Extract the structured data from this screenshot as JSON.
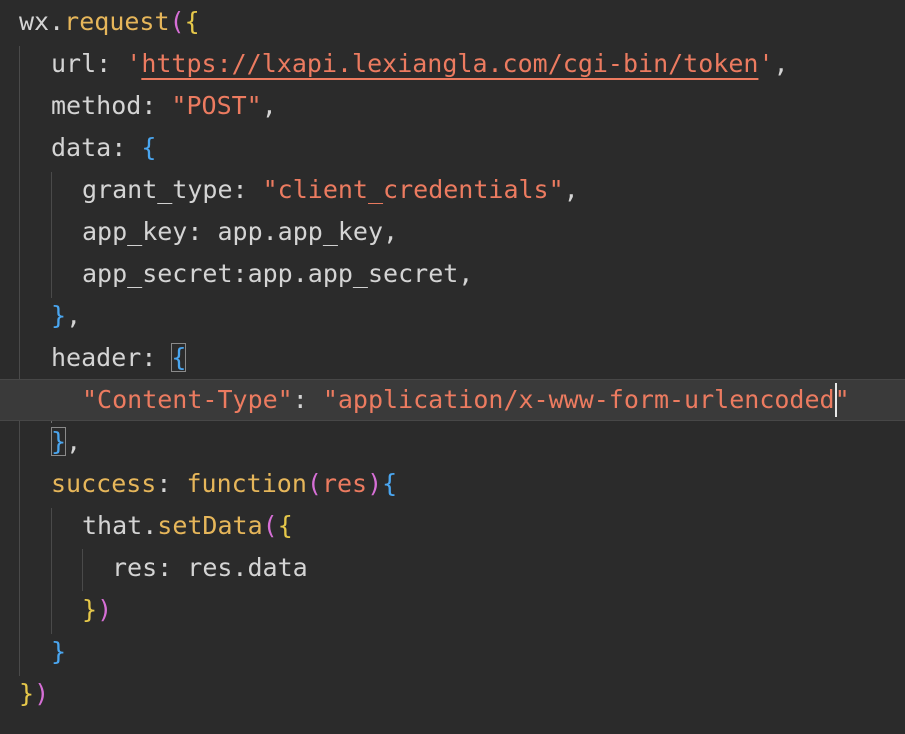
{
  "editor": {
    "language": "javascript",
    "cursor_line": 10,
    "lines": [
      {
        "tokens": [
          {
            "t": "wx",
            "c": "default"
          },
          {
            "t": ".",
            "c": "default"
          },
          {
            "t": "request",
            "c": "func"
          },
          {
            "t": "(",
            "c": "brace1"
          },
          {
            "t": "{",
            "c": "brace2"
          }
        ]
      },
      {
        "tokens": [
          {
            "t": "url",
            "c": "default"
          },
          {
            "t": ": ",
            "c": "default"
          },
          {
            "t": "'",
            "c": "string"
          },
          {
            "t": "https://lxapi.lexiangla.com/cgi-bin/token",
            "c": "url"
          },
          {
            "t": "'",
            "c": "string"
          },
          {
            "t": ",",
            "c": "default"
          }
        ]
      },
      {
        "tokens": [
          {
            "t": "method",
            "c": "default"
          },
          {
            "t": ": ",
            "c": "default"
          },
          {
            "t": "\"POST\"",
            "c": "string"
          },
          {
            "t": ",",
            "c": "default"
          }
        ]
      },
      {
        "tokens": [
          {
            "t": "data",
            "c": "default"
          },
          {
            "t": ": ",
            "c": "default"
          },
          {
            "t": "{",
            "c": "brace3"
          }
        ]
      },
      {
        "tokens": [
          {
            "t": "grant_type",
            "c": "default"
          },
          {
            "t": ": ",
            "c": "default"
          },
          {
            "t": "\"client_credentials\"",
            "c": "string"
          },
          {
            "t": ",",
            "c": "default"
          }
        ]
      },
      {
        "tokens": [
          {
            "t": "app_key",
            "c": "default"
          },
          {
            "t": ": ",
            "c": "default"
          },
          {
            "t": "app.app_key",
            "c": "default"
          },
          {
            "t": ",",
            "c": "default"
          }
        ]
      },
      {
        "tokens": [
          {
            "t": "app_secret",
            "c": "default"
          },
          {
            "t": ":",
            "c": "default"
          },
          {
            "t": "app.app_secret",
            "c": "default"
          },
          {
            "t": ",",
            "c": "default"
          }
        ]
      },
      {
        "tokens": [
          {
            "t": "}",
            "c": "brace3"
          },
          {
            "t": ",",
            "c": "default"
          }
        ]
      },
      {
        "tokens": [
          {
            "t": "header",
            "c": "default"
          },
          {
            "t": ": ",
            "c": "default"
          },
          {
            "t": "{",
            "c": "brace3"
          }
        ]
      },
      {
        "tokens": [
          {
            "t": "\"Content-Type\"",
            "c": "string"
          },
          {
            "t": ": ",
            "c": "default"
          },
          {
            "t": "\"application/x-www-form-urlencoded",
            "c": "string"
          },
          {
            "t": "\"",
            "c": "string"
          }
        ]
      },
      {
        "tokens": [
          {
            "t": "}",
            "c": "brace3"
          },
          {
            "t": ",",
            "c": "default"
          }
        ]
      },
      {
        "tokens": [
          {
            "t": "success",
            "c": "prop"
          },
          {
            "t": ": ",
            "c": "default"
          },
          {
            "t": "function",
            "c": "func"
          },
          {
            "t": "(",
            "c": "brace1"
          },
          {
            "t": "res",
            "c": "string"
          },
          {
            "t": ")",
            "c": "brace1"
          },
          {
            "t": "{",
            "c": "brace3"
          }
        ]
      },
      {
        "tokens": [
          {
            "t": "that",
            "c": "default"
          },
          {
            "t": ".",
            "c": "default"
          },
          {
            "t": "setData",
            "c": "func"
          },
          {
            "t": "(",
            "c": "brace1"
          },
          {
            "t": "{",
            "c": "brace2"
          }
        ]
      },
      {
        "tokens": [
          {
            "t": "res",
            "c": "default"
          },
          {
            "t": ": ",
            "c": "default"
          },
          {
            "t": "res.data",
            "c": "default"
          }
        ]
      },
      {
        "tokens": [
          {
            "t": "}",
            "c": "brace2"
          },
          {
            "t": ")",
            "c": "brace1"
          }
        ]
      },
      {
        "tokens": [
          {
            "t": "}",
            "c": "brace3"
          }
        ]
      },
      {
        "tokens": [
          {
            "t": "}",
            "c": "brace2"
          },
          {
            "t": ")",
            "c": "brace1"
          }
        ]
      }
    ]
  },
  "colors": {
    "background": "#2b2b2b",
    "current_line": "#3a3a3a",
    "text": "#d4d4d4",
    "string": "#ec7b60",
    "function": "#e6b65a",
    "bracket_magenta": "#d66fd6",
    "bracket_yellow": "#e6c84a",
    "bracket_blue": "#4aa6f0"
  }
}
